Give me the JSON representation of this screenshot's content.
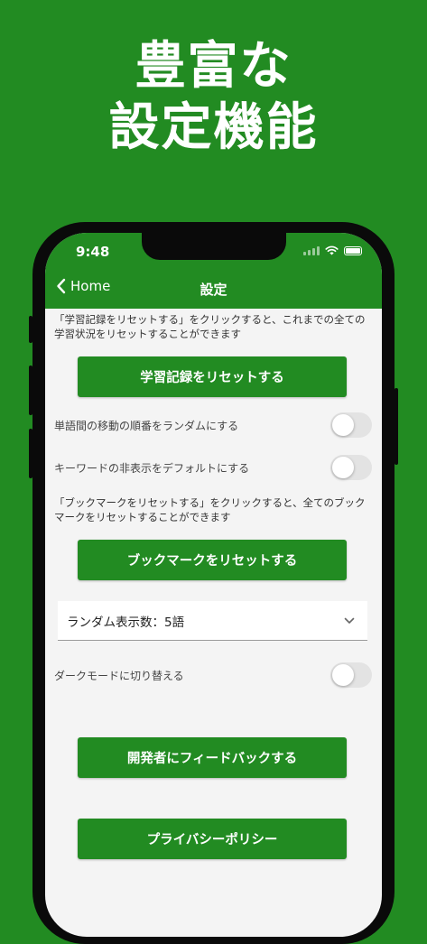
{
  "hero": {
    "line1": "豊富な",
    "line2": "設定機能"
  },
  "status_bar": {
    "time": "9:48"
  },
  "nav": {
    "back_label": "Home",
    "title": "設定"
  },
  "settings": {
    "reset_study_desc": "「学習記録をリセットする」をクリックすると、これまでの全ての学習状況をリセットすることができます",
    "reset_study_button": "学習記録をリセットする",
    "random_order_label": "単語間の移動の順番をランダムにする",
    "random_order_on": false,
    "hide_keyword_label": "キーワードの非表示をデフォルトにする",
    "hide_keyword_on": false,
    "reset_bookmark_desc": "「ブックマークをリセットする」をクリックすると、全てのブックマークをリセットすることができます",
    "reset_bookmark_button": "ブックマークをリセットする",
    "random_count_select": "ランダム表示数：5語",
    "dark_mode_label": "ダークモードに切り替える",
    "dark_mode_on": false,
    "feedback_button": "開発者にフィードバックする",
    "privacy_button": "プライバシーポリシー"
  },
  "colors": {
    "brand_green": "#228b22",
    "screen_bg": "#f4f4f4"
  },
  "icons": [
    "chevron-left-icon",
    "wifi-icon",
    "battery-icon",
    "chevron-down-icon"
  ]
}
